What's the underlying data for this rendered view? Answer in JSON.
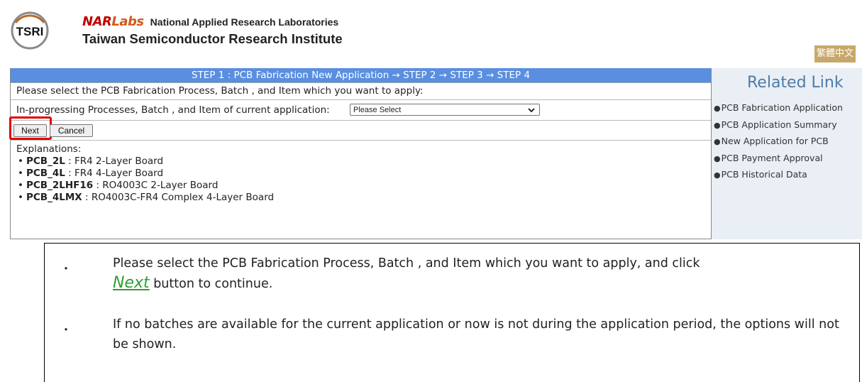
{
  "header": {
    "logo_text": "TSRI",
    "nar_brand_part1": "NAR",
    "nar_brand_part2": "Labs",
    "nar_full": "National Applied Research Laboratories",
    "tsri_full": "Taiwan Semiconductor Research Institute",
    "lang_button": "繁體中文"
  },
  "main": {
    "step_bar": "STEP 1 : PCB Fabrication New Application → STEP 2 → STEP 3 → STEP 4",
    "instruction": "Please select the PCB Fabrication Process, Batch , and Item which you want to apply:",
    "select_label": "In-progressing Processes, Batch , and Item of current application:",
    "select_value": "Please Select",
    "next_label": "Next",
    "cancel_label": "Cancel",
    "explanations_title": "Explanations:",
    "explanations": [
      {
        "code": "PCB_2L",
        "desc": " : FR4 2-Layer Board"
      },
      {
        "code": "PCB_4L",
        "desc": " : FR4 4-Layer Board"
      },
      {
        "code": "PCB_2LHF16",
        "desc": " : RO4003C 2-Layer Board"
      },
      {
        "code": "PCB_4LMX",
        "desc": " : RO4003C-FR4 Complex 4-Layer Board"
      }
    ]
  },
  "related": {
    "title": "Related Link",
    "bullet": "●",
    "links": [
      "PCB Fabrication Application",
      "PCB Application Summary",
      "New Application for PCB",
      "PCB Payment Approval",
      "PCB Historical Data"
    ]
  },
  "instructions": {
    "bullet": "・",
    "line1_part1": "Please select the PCB Fabrication Process, Batch , and Item which you want to apply, and click",
    "next_word": "Next",
    "line1_part2": " button to continue.",
    "line2": "If no batches are available for the current application or now is not during the application period, the options will not be shown."
  },
  "colors": {
    "step_bar": "#5a8ee0",
    "related_bg": "#e9eff5",
    "lang_button": "#c8a86a",
    "highlight": "#e00000",
    "next_word": "#2e9e33"
  }
}
